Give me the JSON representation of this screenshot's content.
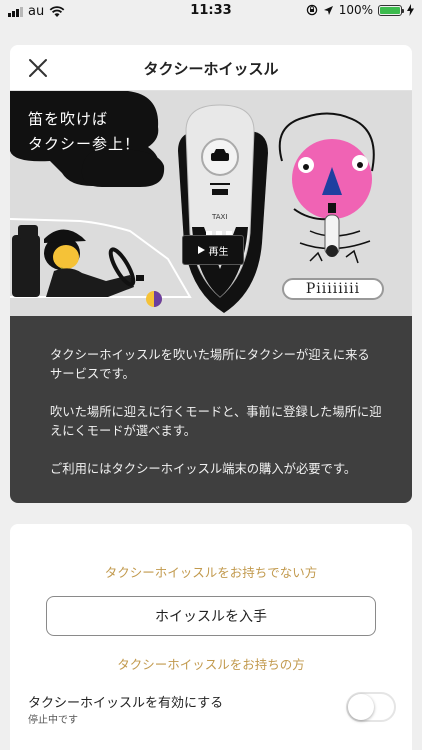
{
  "status_bar": {
    "carrier": "au",
    "time": "11:33",
    "battery_percent": "100%",
    "battery_level": 1.0,
    "icons": [
      "signal-icon",
      "wifi-icon",
      "lock-rotation-icon",
      "location-icon",
      "battery-icon",
      "charging-icon"
    ]
  },
  "header": {
    "title": "タクシーホイッスル",
    "close_icon": "close-icon"
  },
  "banner": {
    "bubble_line1": "笛を吹けば",
    "bubble_line2": "タクシー参上！",
    "play_label": "再生",
    "piii_label": "Piiiiiiii",
    "whistle_brand": "TAXI"
  },
  "description": {
    "p1": "タクシーホイッスルを吹いた場所にタクシーが迎えに来るサービスです。",
    "p2": "吹いた場所に迎えに行くモードと、事前に登録した場所に迎えにくモードが選べます。",
    "p3": "ご利用にはタクシーホイッスル端末の購入が必要です。"
  },
  "purchase": {
    "no_whistle_text": "タクシーホイッスルをお持ちでない方",
    "get_button": "ホイッスルを入手",
    "have_whistle_text": "タクシーホイッスルをお持ちの方"
  },
  "activation": {
    "label": "タクシーホイッスルを有効にする",
    "status": "停止中です",
    "enabled": false
  },
  "colors": {
    "accent": "#c29a4e",
    "description_bg": "#3f3f3f",
    "banner_bg": "#dcdcdc",
    "face_pink": "#f063b4",
    "battery_green": "#3dbb4e"
  }
}
